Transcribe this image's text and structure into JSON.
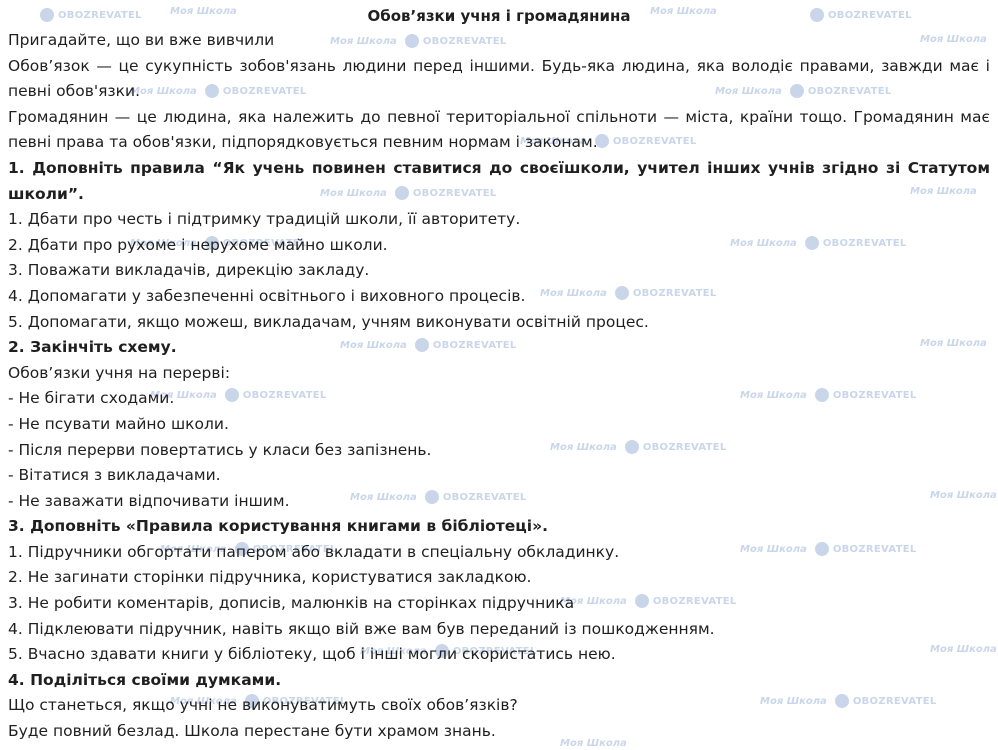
{
  "title": "Обов’язки учня і громадянина",
  "intro": "Пригадайте, що ви вже вивчили",
  "definitions": [
    "Обов’язок — це сукупність зобов'язань людини перед іншими. Будь-яка людина, яка володіє правами, завжди має і певні обов'язки.",
    "Громадянин — це людина, яка належить до певної територіальної спільноти — міста, країни тощо. Громадянин має певні права та обов'язки, підпорядковується певним нормам і законам."
  ],
  "task1": {
    "heading": "1. Доповніть правила “Як учень повинен ставитися до своєїшколи, учител інших учнів згідно зі Статутом школи”.",
    "items": [
      "1. Дбати про честь і підтримку традицій школи, її авторитету.",
      "2. Дбати про рухоме і нерухоме майно школи.",
      "3. Поважати викладачів, дирекцію закладу.",
      "4. Допомагати у забезпеченні освітнього і виховного процесів.",
      "5. Допомагати, якщо можеш, викладачам, учням виконувати освітній процес."
    ]
  },
  "task2": {
    "heading": "2. Закінчіть схему.",
    "subheading": "Обов’язки учня на перерві:",
    "items": [
      "- Не бігати сходами.",
      "- Не псувати майно школи.",
      "- Після перерви повертатись у класи без запізнень.",
      "- Вітатися з викладачами.",
      "- Не заважати відпочивати іншим."
    ]
  },
  "task3": {
    "heading": "3. Доповніть «Правила користування книгами в бібліотеці».",
    "items": [
      "1. Підручники обгортати папером або вкладати в спеціальну обкладинку.",
      "2. Не загинати сторінки підручника, користуватися закладкою.",
      "3. Не робити коментарів, дописів, малюнків на сторінках підручника",
      "4. Підклеювати підручник, навіть якщо вій вже вам був переданий із пошкодженням.",
      "5. Вчасно здавати книги у бібліотеку, щоб і інші могли скористатись нею."
    ]
  },
  "task4": {
    "heading": "4. Поділіться своїми думками.",
    "question": "Що станеться, якщо учні не виконуватимуть своїх обов’язків?",
    "answer": "Буде повний безлад. Школа перестане бути храмом знань."
  },
  "watermark": {
    "brand1": "Моя Школа",
    "brand2": "OBOZREVATEL",
    "color": "#c9d6ea"
  }
}
